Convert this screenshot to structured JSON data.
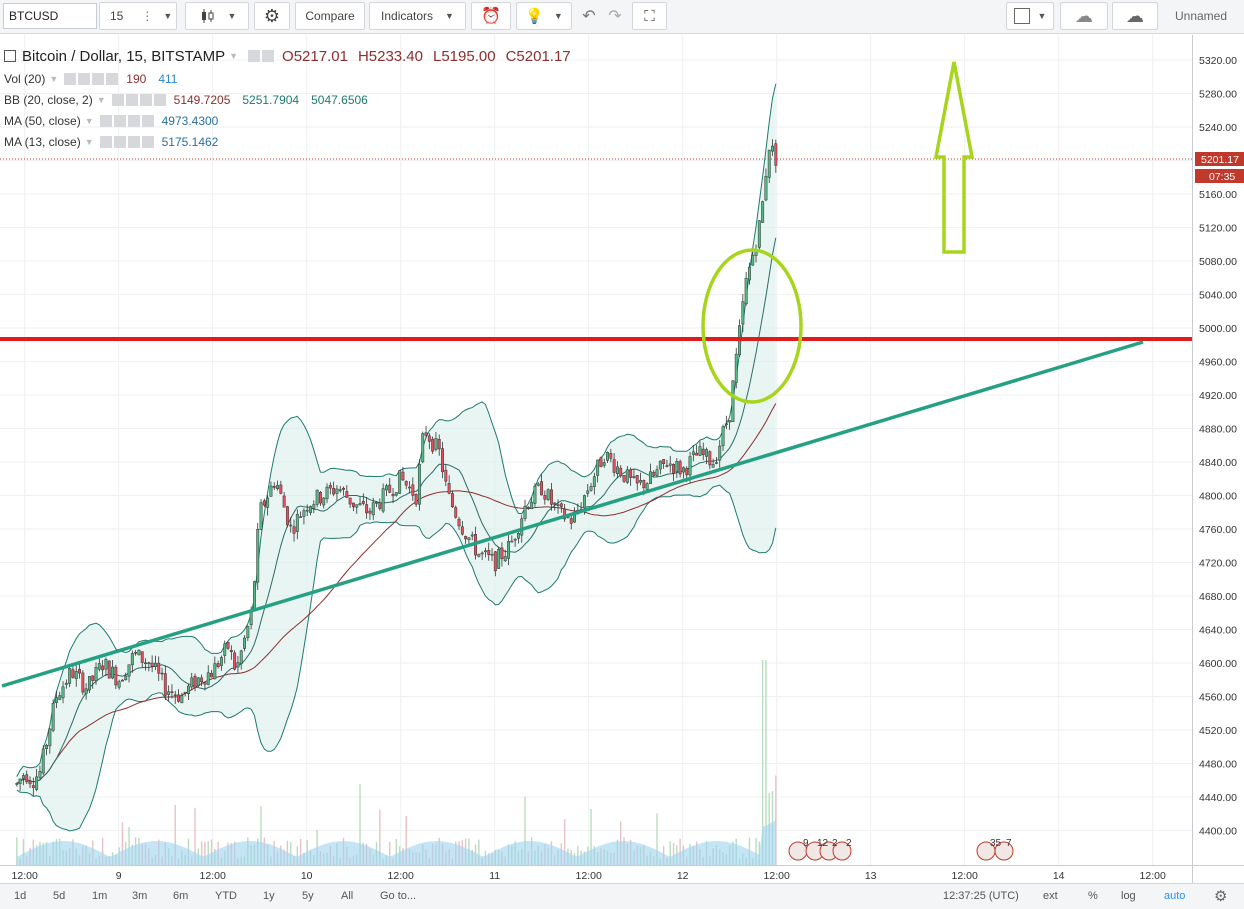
{
  "toolbar": {
    "symbol": "BTCUSD",
    "interval": "15",
    "compare_label": "Compare",
    "indicators_label": "Indicators",
    "unnamed_label": "Unnamed"
  },
  "legend": {
    "title": "Bitcoin / Dollar, 15, BITSTAMP",
    "open": "O5217.01",
    "high": "H5233.40",
    "low": "L5195.00",
    "close": "C5201.17",
    "vol_name": "Vol (20)",
    "vol_v1": "190",
    "vol_v2": "411",
    "bb_name": "BB (20, close, 2)",
    "bb_basis": "5149.7205",
    "bb_upper": "5251.7904",
    "bb_lower": "5047.6506",
    "ma50_name": "MA (50, close)",
    "ma50_value": "4973.4300",
    "ma13_name": "MA (13, close)",
    "ma13_value": "5175.1462"
  },
  "price_axis": {
    "ticks": [
      "5320.00",
      "5280.00",
      "5240.00",
      "5200.00",
      "5160.00",
      "5120.00",
      "5080.00",
      "5040.00",
      "5000.00",
      "4960.00",
      "4920.00",
      "4880.00",
      "4840.00",
      "4800.00",
      "4760.00",
      "4720.00",
      "4680.00",
      "4640.00",
      "4600.00",
      "4560.00",
      "4520.00",
      "4480.00",
      "4440.00",
      "4400.00"
    ],
    "last_price": "5201.17",
    "countdown": "07:35"
  },
  "time_axis": {
    "labels": [
      "12:00",
      "9",
      "12:00",
      "10",
      "12:00",
      "11",
      "12:00",
      "12",
      "12:00",
      "13",
      "12:00",
      "14",
      "12:00"
    ]
  },
  "events": {
    "group1": [
      "9",
      "12",
      "2",
      "2"
    ],
    "group2": [
      "35",
      "7"
    ]
  },
  "bottom": {
    "ranges": [
      "1d",
      "5d",
      "1m",
      "3m",
      "6m",
      "YTD",
      "1y",
      "5y",
      "All"
    ],
    "goto": "Go to...",
    "clock": "12:37:25 (UTC)",
    "ext": "ext",
    "percent": "%",
    "log": "log",
    "auto": "auto"
  },
  "colors": {
    "up": "#53b987",
    "down": "#eb4d5c",
    "bb": "#1e7a70",
    "ma50": "#8b2f2f",
    "ma13": "#2b6c64",
    "support": "#26a083",
    "resistance": "#e01b1b",
    "annotation": "#a7d51c",
    "volume": "#bde4f5",
    "accent": "#2196f3"
  },
  "chart_data": {
    "type": "line",
    "series": [
      {
        "name": "BTCUSD",
        "x": [
          "8 11:00",
          "8 12:00",
          "8 13:00",
          "8 14:00",
          "8 16:00",
          "8 18:00",
          "8 20:00",
          "8 22:00",
          "9 00:00",
          "9 02:00",
          "9 04:00",
          "9 06:00",
          "9 08:00",
          "9 10:00",
          "9 12:00",
          "9 14:00",
          "9 15:00",
          "9 17:00",
          "9 18:00",
          "9 20:00",
          "9 22:00",
          "10 00:00",
          "10 02:00",
          "10 04:00",
          "10 06:00",
          "10 08:00",
          "10 10:00",
          "10 12:00",
          "10 14:00",
          "10 15:00",
          "10 17:00",
          "10 18:00",
          "10 20:00",
          "10 22:00",
          "11 00:00",
          "11 02:00",
          "11 04:00",
          "11 06:00",
          "11 08:00",
          "11 10:00",
          "11 12:00",
          "11 14:00",
          "11 16:00",
          "11 18:00",
          "11 20:00",
          "11 22:00",
          "12 00:00",
          "12 02:00",
          "12 04:00",
          "12 06:00",
          "12 08:00",
          "12 09:00",
          "12 10:00",
          "12 11:00",
          "12 11:30",
          "12 12:00"
        ],
        "values": [
          4455,
          4470,
          4460,
          4470,
          4560,
          4590,
          4570,
          4600,
          4580,
          4610,
          4600,
          4570,
          4560,
          4580,
          4590,
          4620,
          4590,
          4660,
          4780,
          4820,
          4760,
          4790,
          4800,
          4810,
          4790,
          4780,
          4800,
          4820,
          4800,
          4880,
          4850,
          4800,
          4760,
          4730,
          4720,
          4740,
          4790,
          4810,
          4780,
          4770,
          4810,
          4850,
          4830,
          4810,
          4820,
          4840,
          4830,
          4850,
          4840,
          4900,
          5050,
          5090,
          5130,
          5220,
          5210,
          5201
        ]
      }
    ],
    "ylim": [
      4370,
      5340
    ],
    "xlim": [
      "8 10:00",
      "14 18:00"
    ]
  }
}
